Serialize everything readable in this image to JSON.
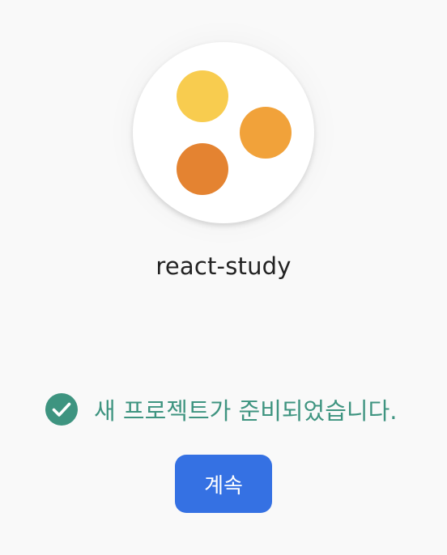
{
  "project": {
    "name": "react-study",
    "logo_dot_colors": [
      "#f8cc4f",
      "#f1a23a",
      "#e48331"
    ]
  },
  "status": {
    "message": "새 프로젝트가 준비되었습니다.",
    "icon": "check-circle-icon",
    "color": "#3e9480"
  },
  "actions": {
    "continue_label": "계속",
    "continue_color": "#3571e3"
  }
}
